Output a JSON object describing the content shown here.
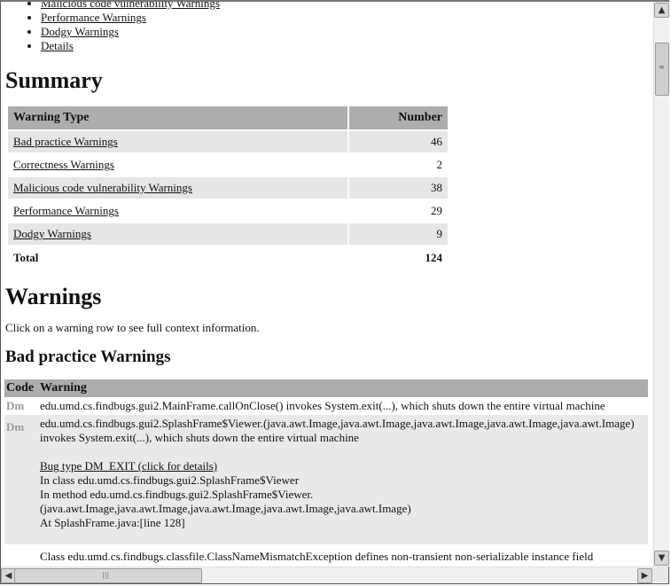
{
  "toc": {
    "items": [
      {
        "label": "Malicious code vulnerability Warnings"
      },
      {
        "label": "Performance Warnings"
      },
      {
        "label": "Dodgy Warnings"
      },
      {
        "label": "Details"
      }
    ]
  },
  "summary": {
    "heading": "Summary",
    "columns": {
      "type": "Warning Type",
      "number": "Number"
    },
    "rows": [
      {
        "type": "Bad practice Warnings",
        "number": "46"
      },
      {
        "type": "Correctness Warnings",
        "number": "2"
      },
      {
        "type": "Malicious code vulnerability Warnings",
        "number": "38"
      },
      {
        "type": "Performance Warnings",
        "number": "29"
      },
      {
        "type": "Dodgy Warnings",
        "number": "9"
      }
    ],
    "total": {
      "label": "Total",
      "number": "124"
    }
  },
  "warnings": {
    "heading": "Warnings",
    "note": "Click on a warning row to see full context information.",
    "section_heading": "Bad practice Warnings",
    "columns": {
      "code": "Code",
      "warning": "Warning"
    },
    "rows": [
      {
        "code": "Dm",
        "text": "edu.umd.cs.findbugs.gui2.MainFrame.callOnClose() invokes System.exit(...), which shuts down the entire virtual machine"
      },
      {
        "code": "Dm",
        "text": "edu.umd.cs.findbugs.gui2.SplashFrame$Viewer.(java.awt.Image,java.awt.Image,java.awt.Image,java.awt.Image,java.awt.Image) invokes System.exit(...), which shuts down the entire virtual machine",
        "details": {
          "bug_type_link": "Bug type DM_EXIT (click for details)",
          "in_class": "In class edu.umd.cs.findbugs.gui2.SplashFrame$Viewer",
          "in_method": "In method edu.umd.cs.findbugs.gui2.SplashFrame$Viewer.(java.awt.Image,java.awt.Image,java.awt.Image,java.awt.Image,java.awt.Image)",
          "at_line": "At SplashFrame.java:[line 128]"
        }
      },
      {
        "code": "",
        "text": "Class edu.umd.cs.findbugs.classfile.ClassNameMismatchException defines non-transient non-serializable instance field"
      }
    ]
  },
  "scrollbars": {
    "up_icon": "▲",
    "down_icon": "▼",
    "left_icon": "◀",
    "right_icon": "▶",
    "grip": "≡",
    "hgrip": "|||"
  }
}
